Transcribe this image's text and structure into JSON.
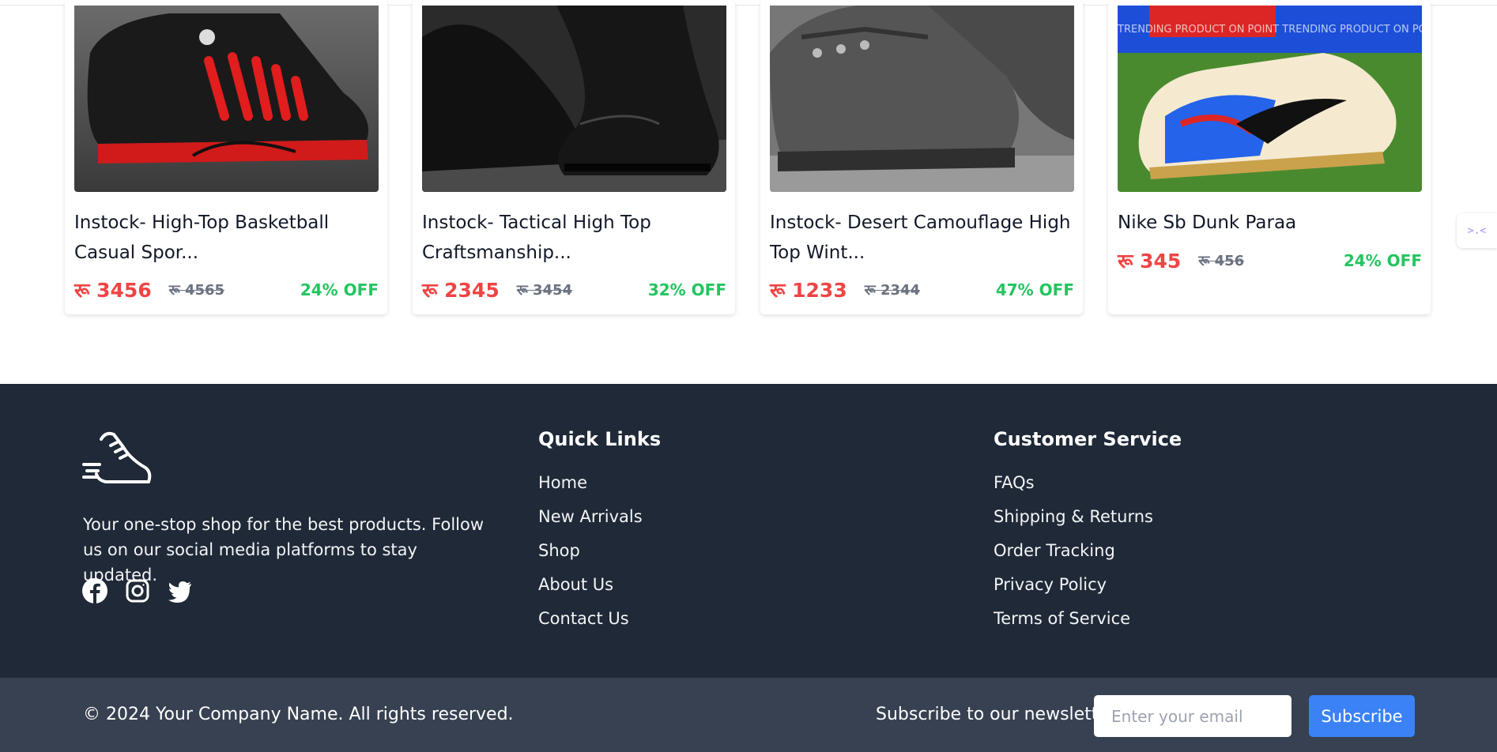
{
  "products": [
    {
      "title": "Instock- High-Top Basketball Casual Spor...",
      "price": "रू 3456",
      "old_price": "रू 4565",
      "discount": "24% OFF",
      "image": "red-black-sneaker"
    },
    {
      "title": "Instock- Tactical High Top Craftsmanship...",
      "price": "रू 2345",
      "old_price": "रू 3454",
      "discount": "32% OFF",
      "image": "black-leather-boot"
    },
    {
      "title": "Instock- Desert Camouflage High Top Wint...",
      "price": "रू 1233",
      "old_price": "रू 2344",
      "discount": "47% OFF",
      "image": "grey-camo-boot"
    },
    {
      "title": "Nike Sb Dunk Paraa",
      "price": "रू 345",
      "old_price": "रू 456",
      "discount": "24% OFF",
      "image": "nike-dunk-sneaker",
      "banner_text": "TRENDING PRODUCT ON POINT TRENDING PRODUCT ON POINT"
    }
  ],
  "footer": {
    "description": "Your one-stop shop for the best products. Follow us on our social media platforms to stay updated.",
    "social_icons": [
      "facebook-icon",
      "instagram-icon",
      "twitter-icon"
    ],
    "quick_links": {
      "heading": "Quick Links",
      "items": [
        "Home",
        "New Arrivals",
        "Shop",
        "About Us",
        "Contact Us"
      ]
    },
    "customer_service": {
      "heading": "Customer Service",
      "items": [
        "FAQs",
        "Shipping & Returns",
        "Order Tracking",
        "Privacy Policy",
        "Terms of Service"
      ]
    }
  },
  "bottom": {
    "copyright": "© 2024 Your Company Name. All rights reserved.",
    "newsletter_label": "Subscribe to our newsletter:",
    "email_placeholder": "Enter your email",
    "subscribe_label": "Subscribe"
  },
  "side_tab_glyph": ">.<",
  "colors": {
    "price": "#ef4444",
    "discount": "#22c55e",
    "footer_bg": "#1f2937",
    "bottom_bg": "#374151",
    "button": "#3b82f6"
  }
}
